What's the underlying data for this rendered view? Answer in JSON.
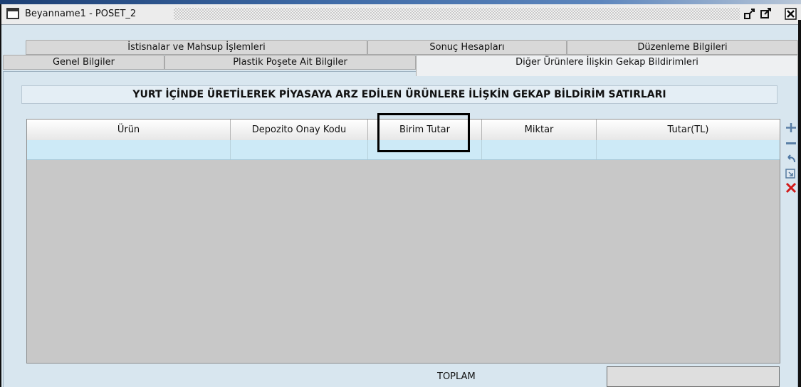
{
  "window": {
    "title": "Beyanname1 - POSET_2",
    "restore_icon": "restore-icon",
    "maximize_icon": "maximize-icon",
    "close_icon": "close-icon"
  },
  "tabs": {
    "row1": [
      {
        "label": "İstisnalar ve Mahsup İşlemleri"
      },
      {
        "label": "Sonuç Hesapları"
      },
      {
        "label": "Düzenleme Bilgileri"
      }
    ],
    "row2": [
      {
        "label": "Genel Bilgiler"
      },
      {
        "label": "Plastik Poşete Ait Bilgiler"
      },
      {
        "label": "Diğer Ürünlere İlişkin Gekap Bildirimleri",
        "active": true
      }
    ]
  },
  "section": {
    "title": "YURT İÇİNDE ÜRETİLEREK PİYASAYA ARZ EDİLEN ÜRÜNLERE İLİŞKİN GEKAP BİLDİRİM SATIRLARI"
  },
  "grid": {
    "columns": [
      "Ürün",
      "Depozito Onay Kodu",
      "Birim Tutar",
      "Miktar",
      "Tutar(TL)"
    ],
    "rows": [
      [
        "",
        "",
        "",
        "",
        ""
      ]
    ]
  },
  "toolbar": {
    "add_icon": "plus-icon",
    "remove_icon": "minus-icon",
    "undo_icon": "undo-icon",
    "import_icon": "import-icon",
    "delete_icon": "delete-icon"
  },
  "totals": {
    "label": "TOPLAM",
    "value": ""
  },
  "colors": {
    "panel_bg": "#d8e6ef",
    "selected_row": "#cdeaf7",
    "grid_bg": "#c8c8c8"
  }
}
